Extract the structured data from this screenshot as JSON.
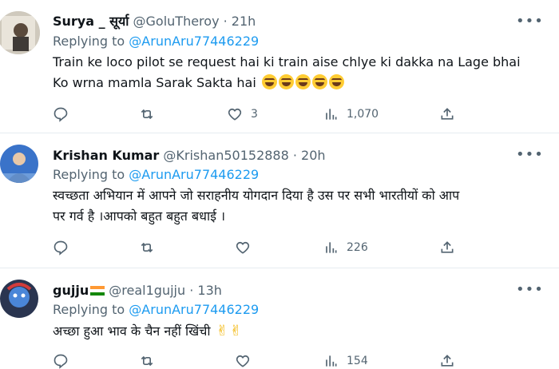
{
  "tweets": [
    {
      "display_name": "Surya _ सूर्या",
      "handle": "@GoluTheroy",
      "time": "· 21h",
      "replying_prefix": "Replying to ",
      "replying_to": "@ArunAru77446229",
      "text_lines": [
        "Train ke loco pilot se request hai ki train aise chlye ki dakka na Lage bhai",
        "Ko wrna mamla Sarak Sakta hai"
      ],
      "trailing_emoji": "face-with-tears-of-joy x5",
      "actions": {
        "reply": "",
        "retweet": "",
        "like": "3",
        "views": "1,070"
      }
    },
    {
      "display_name": "Krishan Kumar",
      "handle": "@Krishan50152888",
      "time": "· 20h",
      "replying_prefix": "Replying to ",
      "replying_to": "@ArunAru77446229",
      "text_lines": [
        "स्वच्छता अभियान में आपने जो सराहनीय योगदान दिया है उस पर सभी भारतीयों को आप",
        "पर गर्व है ।आपको बहुत बहुत बधाई ।"
      ],
      "actions": {
        "reply": "",
        "retweet": "",
        "like": "",
        "views": "226"
      }
    },
    {
      "display_name": "gujju",
      "handle": "@real1gujju",
      "time": "· 13h",
      "replying_prefix": "Replying to ",
      "replying_to": "@ArunAru77446229",
      "text_lines": [
        "अच्छा हुआ भाव के चैन नहीं खिंची"
      ],
      "trailing_emoji": "victory-hand x2",
      "actions": {
        "reply": "",
        "retweet": "",
        "like": "",
        "views": "154"
      }
    }
  ],
  "more_glyph": "•••",
  "colors": {
    "accent": "#1d9bf0",
    "muted": "#536471",
    "text": "#0f1419",
    "divider": "#e6ecf0"
  }
}
